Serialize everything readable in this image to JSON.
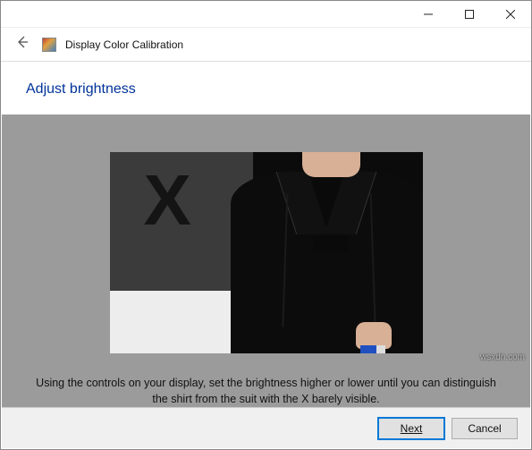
{
  "window": {
    "title": "Display Color Calibration"
  },
  "page": {
    "heading": "Adjust brightness",
    "instruction": "Using the controls on your display, set the brightness higher or lower until you can distinguish the shirt from the suit with the X barely visible."
  },
  "image": {
    "bg_letter": "X",
    "description": "calibration-sample-photo"
  },
  "buttons": {
    "next": "Next",
    "cancel": "Cancel"
  },
  "watermark": "wsxdn.com"
}
